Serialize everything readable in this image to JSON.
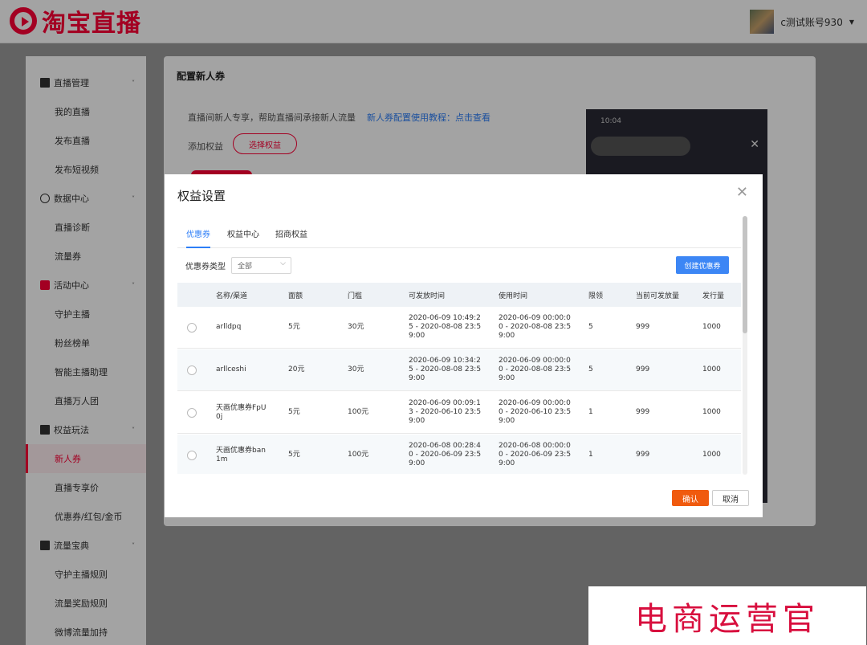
{
  "header": {
    "brand": "淘宝直播",
    "user_name": "c测试账号930"
  },
  "sidebar": {
    "groups": [
      {
        "label": "直播管理",
        "icon": "live-icon",
        "items": [
          "我的直播",
          "发布直播",
          "发布短视频"
        ]
      },
      {
        "label": "数据中心",
        "icon": "data-icon",
        "items": [
          "直播诊断",
          "流量券"
        ]
      },
      {
        "label": "活动中心",
        "icon": "activity-icon",
        "items": [
          "守护主播",
          "粉丝榜单",
          "智能主播助理",
          "直播万人团"
        ]
      },
      {
        "label": "权益玩法",
        "icon": "benefit-icon",
        "items": [
          "新人券",
          "直播专享价",
          "优惠券/红包/金币"
        ]
      },
      {
        "label": "流量宝典",
        "icon": "traffic-icon",
        "items": [
          "守护主播规则",
          "流量奖励规则",
          "微博流量加持"
        ]
      }
    ],
    "active_item": "新人券"
  },
  "main": {
    "title": "配置新人券",
    "intro": "直播间新人专享，帮助直播间承接新人流量",
    "tutorial_link": "新人券配置使用教程：点击查看",
    "add_label": "添加权益",
    "select_button": "选择权益",
    "phone_time": "10:04"
  },
  "modal": {
    "title": "权益设置",
    "tabs": [
      "优惠券",
      "权益中心",
      "招商权益"
    ],
    "active_tab": "优惠券",
    "filter_label": "优惠券类型",
    "filter_value": "全部",
    "create_button": "创建优惠券",
    "columns": [
      "名称/渠道",
      "面额",
      "门槛",
      "可发放时间",
      "使用时间",
      "限领",
      "当前可发放量",
      "发行量"
    ],
    "rows": [
      {
        "name": "arlldpq",
        "amount": "5元",
        "threshold": "30元",
        "issue_time": "2020-06-09 10:49:2\n5 - 2020-08-08 23:5\n9:00",
        "use_time": "2020-06-09 00:00:0\n0 - 2020-08-08 23:5\n9:00",
        "limit": "5",
        "available": "999",
        "total": "1000"
      },
      {
        "name": "arllceshi",
        "amount": "20元",
        "threshold": "30元",
        "issue_time": "2020-06-09 10:34:2\n5 - 2020-08-08 23:5\n9:00",
        "use_time": "2020-06-09 00:00:0\n0 - 2020-08-08 23:5\n9:00",
        "limit": "5",
        "available": "999",
        "total": "1000"
      },
      {
        "name": "天画优惠券FpU\n0j",
        "amount": "5元",
        "threshold": "100元",
        "issue_time": "2020-06-09 00:09:1\n3 - 2020-06-10 23:5\n9:00",
        "use_time": "2020-06-09 00:00:0\n0 - 2020-06-10 23:5\n9:00",
        "limit": "1",
        "available": "999",
        "total": "1000"
      },
      {
        "name": "天画优惠券ban\n1m",
        "amount": "5元",
        "threshold": "100元",
        "issue_time": "2020-06-08 00:28:4\n0 - 2020-06-09 23:5\n9:00",
        "use_time": "2020-06-08 00:00:0\n0 - 2020-06-09 23:5\n9:00",
        "limit": "1",
        "available": "999",
        "total": "1000"
      }
    ],
    "ok_button": "确认",
    "cancel_button": "取消"
  },
  "watermark": "电商运营官",
  "colors": {
    "brand_red": "#ff0036",
    "link_blue": "#2d7ef7",
    "confirm_orange": "#f05a0e"
  }
}
